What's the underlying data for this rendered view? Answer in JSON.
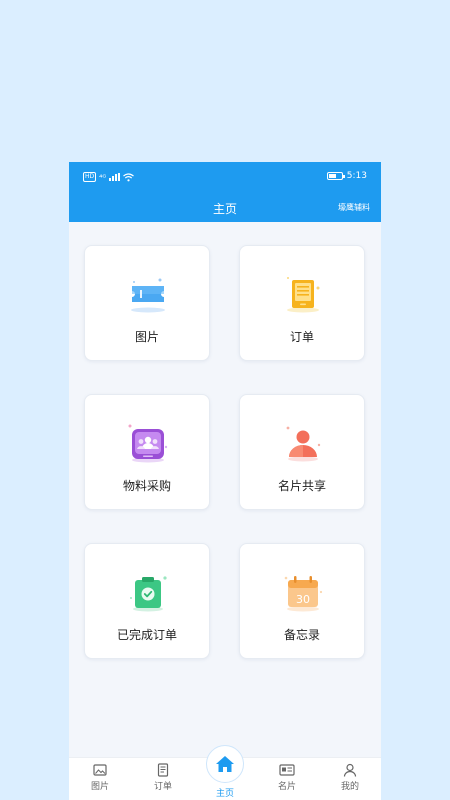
{
  "status_bar": {
    "hd": "HD",
    "network": "⁴ᴳ",
    "time": "5:13"
  },
  "header": {
    "title": "主页",
    "brand": "壕鹰辅料"
  },
  "cards": [
    {
      "label": "图片",
      "icon": "ticket-icon"
    },
    {
      "label": "订单",
      "icon": "document-icon"
    },
    {
      "label": "物料采购",
      "icon": "team-icon"
    },
    {
      "label": "名片共享",
      "icon": "person-icon"
    },
    {
      "label": "已完成订单",
      "icon": "check-bag-icon"
    },
    {
      "label": "备忘录",
      "icon": "calendar-icon",
      "day": "30"
    }
  ],
  "tabs": [
    {
      "label": "图片",
      "icon": "image-icon"
    },
    {
      "label": "订单",
      "icon": "receipt-icon"
    },
    {
      "label": "主页",
      "icon": "home-icon",
      "active": true
    },
    {
      "label": "名片",
      "icon": "card-icon"
    },
    {
      "label": "我的",
      "icon": "user-icon"
    }
  ],
  "colors": {
    "accent": "#1e9bf0",
    "background": "#dbeeff"
  }
}
